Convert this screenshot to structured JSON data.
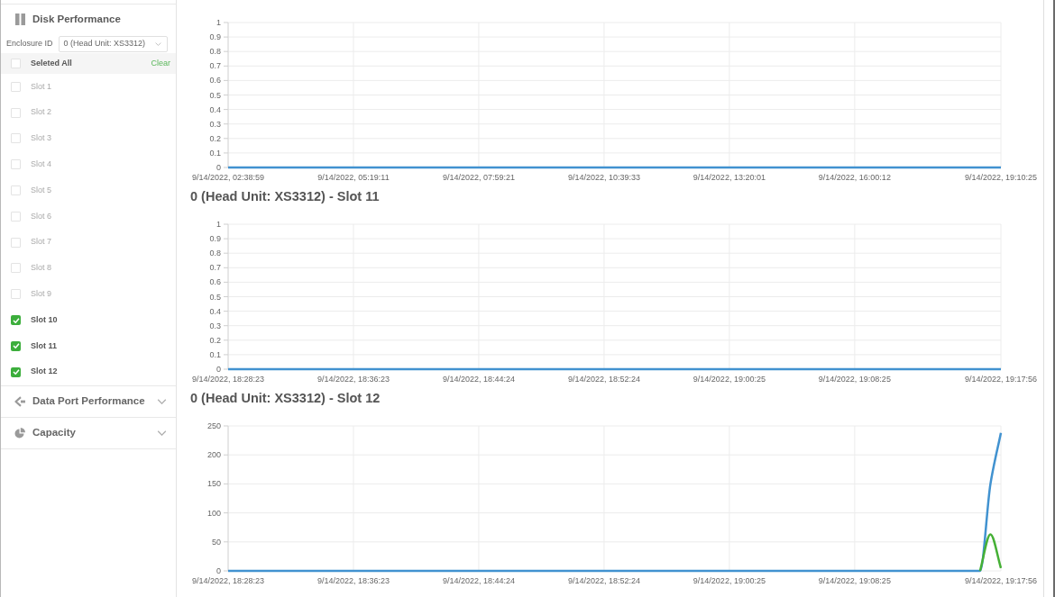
{
  "sidebar": {
    "sections": [
      {
        "title": "Disk Performance",
        "expanded": true,
        "enclosure": {
          "label": "Enclosure ID",
          "value": "0 (Head Unit: XS3312)"
        },
        "select_all": {
          "label": "Seleted All",
          "checked": false,
          "action": "Clear"
        },
        "slots": [
          {
            "label": "Slot 1",
            "checked": false
          },
          {
            "label": "Slot 2",
            "checked": false
          },
          {
            "label": "Slot 3",
            "checked": false
          },
          {
            "label": "Slot 4",
            "checked": false
          },
          {
            "label": "Slot 5",
            "checked": false
          },
          {
            "label": "Slot 6",
            "checked": false
          },
          {
            "label": "Slot 7",
            "checked": false
          },
          {
            "label": "Slot 8",
            "checked": false
          },
          {
            "label": "Slot 9",
            "checked": false
          },
          {
            "label": "Slot 10",
            "checked": true
          },
          {
            "label": "Slot 11",
            "checked": true
          },
          {
            "label": "Slot 12",
            "checked": true
          }
        ]
      },
      {
        "title": "Data Port Performance",
        "expanded": false
      },
      {
        "title": "Capacity",
        "expanded": false
      }
    ]
  },
  "charts": [
    {
      "chart_data": {
        "type": "line",
        "grid": true,
        "categories": [
          "9/14/2022, 02:38:59",
          null,
          null,
          null,
          null,
          null,
          null,
          null,
          null,
          null,
          null,
          null,
          "9/14/2022, 05:19:11",
          null,
          null,
          null,
          null,
          null,
          null,
          null,
          null,
          null,
          null,
          null,
          "9/14/2022, 07:59:21",
          null,
          null,
          null,
          null,
          null,
          null,
          null,
          null,
          null,
          null,
          null,
          "9/14/2022, 10:39:33",
          null,
          null,
          null,
          null,
          null,
          null,
          null,
          null,
          null,
          null,
          null,
          "9/14/2022, 13:20:01",
          null,
          null,
          null,
          null,
          null,
          null,
          null,
          null,
          null,
          null,
          null,
          "9/14/2022, 16:00:12",
          null,
          null,
          null,
          null,
          null,
          null,
          null,
          null,
          null,
          null,
          null,
          null,
          null,
          "9/14/2022, 19:10:25"
        ],
        "series": [
          {
            "color": "#4192d0",
            "values": [
              0,
              0,
              0,
              0,
              0,
              0,
              0,
              0,
              0,
              0,
              0,
              0,
              0,
              0,
              0,
              0,
              0,
              0,
              0,
              0,
              0,
              0,
              0,
              0,
              0,
              0,
              0,
              0,
              0,
              0,
              0,
              0,
              0,
              0,
              0,
              0,
              0,
              0,
              0,
              0,
              0,
              0,
              0,
              0,
              0,
              0,
              0,
              0,
              0,
              0,
              0,
              0,
              0,
              0,
              0,
              0,
              0,
              0,
              0,
              0,
              0,
              0,
              0,
              0,
              0,
              0,
              0,
              0,
              0,
              0,
              0,
              0,
              0,
              0,
              0
            ]
          }
        ],
        "ylim": [
          0,
          1
        ],
        "yticks": [
          0,
          0.1,
          0.2,
          0.3,
          0.4,
          0.5,
          0.6,
          0.7,
          0.8,
          0.9,
          1
        ]
      }
    },
    {
      "title": "0 (Head Unit: XS3312) - Slot 11",
      "chart_data": {
        "type": "line",
        "grid": true,
        "categories": [
          "9/14/2022, 18:28:23",
          null,
          null,
          null,
          null,
          null,
          null,
          null,
          null,
          null,
          null,
          null,
          "9/14/2022, 18:36:23",
          null,
          null,
          null,
          null,
          null,
          null,
          null,
          null,
          null,
          null,
          null,
          "9/14/2022, 18:44:24",
          null,
          null,
          null,
          null,
          null,
          null,
          null,
          null,
          null,
          null,
          null,
          "9/14/2022, 18:52:24",
          null,
          null,
          null,
          null,
          null,
          null,
          null,
          null,
          null,
          null,
          null,
          "9/14/2022, 19:00:25",
          null,
          null,
          null,
          null,
          null,
          null,
          null,
          null,
          null,
          null,
          null,
          "9/14/2022, 19:08:25",
          null,
          null,
          null,
          null,
          null,
          null,
          null,
          null,
          null,
          null,
          null,
          null,
          null,
          "9/14/2022, 19:17:56"
        ],
        "series": [
          {
            "color": "#4192d0",
            "values": [
              0,
              0,
              0,
              0,
              0,
              0,
              0,
              0,
              0,
              0,
              0,
              0,
              0,
              0,
              0,
              0,
              0,
              0,
              0,
              0,
              0,
              0,
              0,
              0,
              0,
              0,
              0,
              0,
              0,
              0,
              0,
              0,
              0,
              0,
              0,
              0,
              0,
              0,
              0,
              0,
              0,
              0,
              0,
              0,
              0,
              0,
              0,
              0,
              0,
              0,
              0,
              0,
              0,
              0,
              0,
              0,
              0,
              0,
              0,
              0,
              0,
              0,
              0,
              0,
              0,
              0,
              0,
              0,
              0,
              0,
              0,
              0,
              0,
              0,
              0
            ]
          }
        ],
        "ylim": [
          0,
          1
        ],
        "yticks": [
          0,
          0.1,
          0.2,
          0.3,
          0.4,
          0.5,
          0.6,
          0.7,
          0.8,
          0.9,
          1
        ]
      }
    },
    {
      "title": "0 (Head Unit: XS3312) - Slot 12",
      "chart_data": {
        "type": "line",
        "grid": true,
        "categories": [
          "9/14/2022, 18:28:23",
          null,
          null,
          null,
          null,
          null,
          null,
          null,
          null,
          null,
          null,
          null,
          "9/14/2022, 18:36:23",
          null,
          null,
          null,
          null,
          null,
          null,
          null,
          null,
          null,
          null,
          null,
          "9/14/2022, 18:44:24",
          null,
          null,
          null,
          null,
          null,
          null,
          null,
          null,
          null,
          null,
          null,
          "9/14/2022, 18:52:24",
          null,
          null,
          null,
          null,
          null,
          null,
          null,
          null,
          null,
          null,
          null,
          "9/14/2022, 19:00:25",
          null,
          null,
          null,
          null,
          null,
          null,
          null,
          null,
          null,
          null,
          null,
          "9/14/2022, 19:08:25",
          null,
          null,
          null,
          null,
          null,
          null,
          null,
          null,
          null,
          null,
          null,
          null,
          null,
          "9/14/2022, 19:17:56"
        ],
        "series": [
          {
            "color": "#4192d0",
            "values": [
              0,
              0,
              0,
              0,
              0,
              0,
              0,
              0,
              0,
              0,
              0,
              0,
              0,
              0,
              0,
              0,
              0,
              0,
              0,
              0,
              0,
              0,
              0,
              0,
              0,
              0,
              0,
              0,
              0,
              0,
              0,
              0,
              0,
              0,
              0,
              0,
              0,
              0,
              0,
              0,
              0,
              0,
              0,
              0,
              0,
              0,
              0,
              0,
              0,
              0,
              0,
              0,
              0,
              0,
              0,
              0,
              0,
              0,
              0,
              0,
              0,
              0,
              0,
              0,
              0,
              0,
              0,
              0,
              0,
              0,
              0,
              0,
              0,
              150,
              238
            ]
          },
          {
            "color": "#45b035",
            "values": [
              null,
              null,
              null,
              null,
              null,
              null,
              null,
              null,
              null,
              null,
              null,
              null,
              null,
              null,
              null,
              null,
              null,
              null,
              null,
              null,
              null,
              null,
              null,
              null,
              null,
              null,
              null,
              null,
              null,
              null,
              null,
              null,
              null,
              null,
              null,
              null,
              null,
              null,
              null,
              null,
              null,
              null,
              null,
              null,
              null,
              null,
              null,
              null,
              null,
              null,
              null,
              null,
              null,
              null,
              null,
              null,
              null,
              null,
              null,
              null,
              null,
              null,
              null,
              null,
              null,
              null,
              null,
              null,
              null,
              null,
              null,
              null,
              0,
              63,
              5
            ]
          }
        ],
        "ylim": [
          0,
          250
        ],
        "yticks": [
          0,
          50,
          100,
          150,
          200,
          250
        ]
      }
    }
  ]
}
